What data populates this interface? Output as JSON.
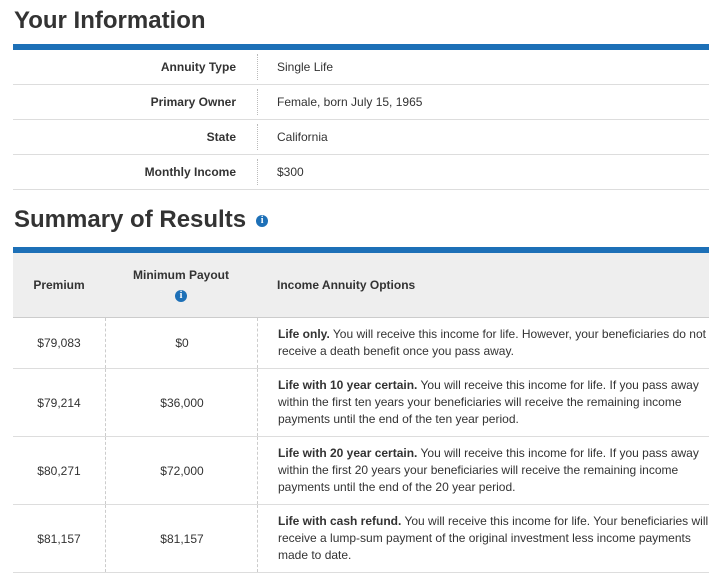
{
  "info": {
    "title": "Your Information",
    "rows": [
      {
        "label": "Annuity Type",
        "value": "Single Life"
      },
      {
        "label": "Primary Owner",
        "value": "Female, born July 15, 1965"
      },
      {
        "label": "State",
        "value": "California"
      },
      {
        "label": "Monthly Income",
        "value": "$300"
      }
    ]
  },
  "results": {
    "title": "Summary of Results",
    "headers": {
      "premium": "Premium",
      "minimum_payout": "Minimum Payout",
      "options": "Income Annuity Options"
    },
    "rows": [
      {
        "premium": "$79,083",
        "minimum_payout": "$0",
        "option_title": "Life only.",
        "option_text": " You will receive this income for life. However, your beneficiaries do not receive a death benefit once you pass away."
      },
      {
        "premium": "$79,214",
        "minimum_payout": "$36,000",
        "option_title": "Life with 10 year certain.",
        "option_text": " You will receive this income for life. If you pass away within the first ten years your beneficiaries will receive the remaining income payments until the end of the ten year period."
      },
      {
        "premium": "$80,271",
        "minimum_payout": "$72,000",
        "option_title": "Life with 20 year certain.",
        "option_text": " You will receive this income for life. If you pass away within the first 20 years your beneficiaries will receive the remaining income payments until the end of the 20 year period."
      },
      {
        "premium": "$81,157",
        "minimum_payout": "$81,157",
        "option_title": "Life with cash refund.",
        "option_text": " You will receive this income for life. Your beneficiaries will receive a lump-sum payment of the original investment less income payments made to date."
      }
    ]
  },
  "icons": {
    "info_glyph": "i",
    "info_color": "#1d70b7"
  },
  "colors": {
    "accent": "#1d70b7",
    "header_bg": "#eeeeee",
    "text": "#333333"
  }
}
